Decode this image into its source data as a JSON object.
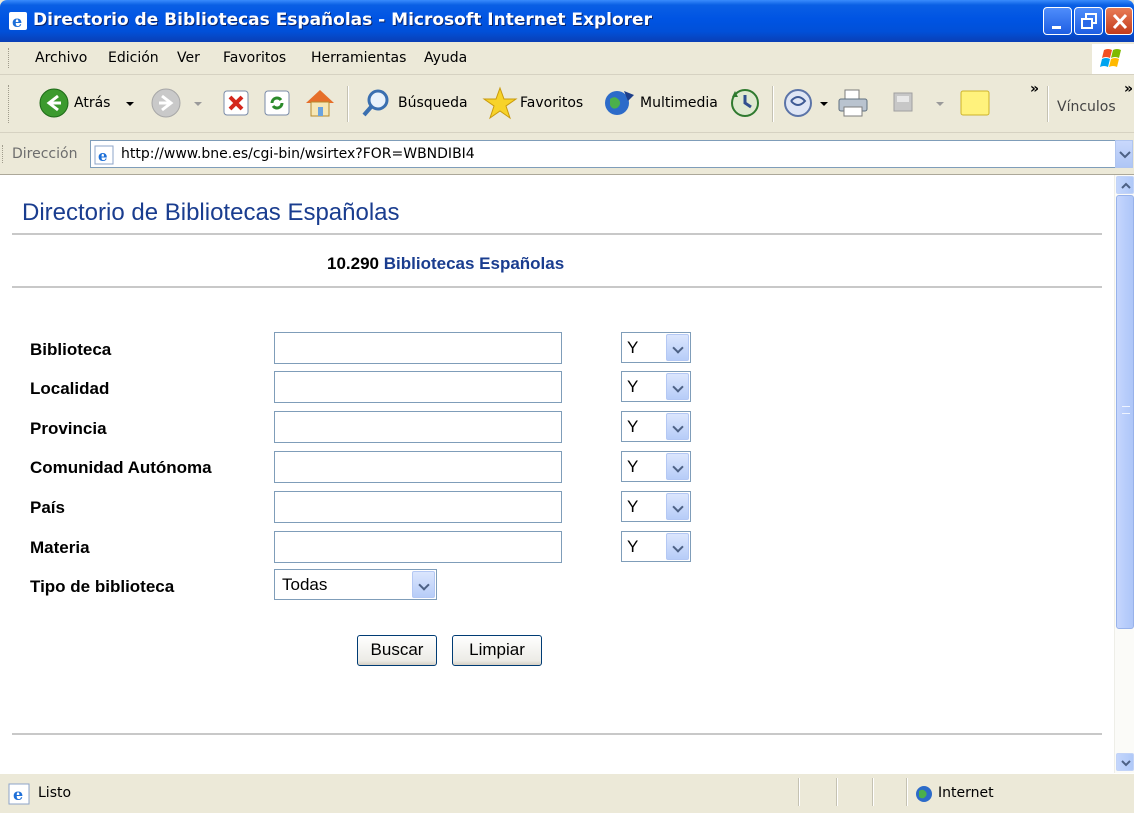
{
  "window": {
    "title": "Directorio de Bibliotecas Españolas - Microsoft Internet Explorer"
  },
  "menu": {
    "items": [
      "Archivo",
      "Edición",
      "Ver",
      "Favoritos",
      "Herramientas",
      "Ayuda"
    ]
  },
  "toolbar": {
    "back_label": "Atrás",
    "search_label": "Búsqueda",
    "favorites_label": "Favoritos",
    "media_label": "Multimedia",
    "links_label": "Vínculos",
    "more_symbol": "»"
  },
  "address_bar": {
    "label": "Dirección",
    "url": "http://www.bne.es/cgi-bin/wsirtex?FOR=WBNDIBI4"
  },
  "page": {
    "title": "Directorio de Bibliotecas Españolas",
    "count_number": "10.290",
    "count_label": "Bibliotecas Españolas",
    "fields": [
      {
        "label": "Biblioteca",
        "value": "",
        "operator": "Y"
      },
      {
        "label": "Localidad",
        "value": "",
        "operator": "Y"
      },
      {
        "label": "Provincia",
        "value": "",
        "operator": "Y"
      },
      {
        "label": "Comunidad Autónoma",
        "value": "",
        "operator": "Y"
      },
      {
        "label": "País",
        "value": "",
        "operator": "Y"
      },
      {
        "label": "Materia",
        "value": "",
        "operator": "Y"
      }
    ],
    "type_label": "Tipo de biblioteca",
    "type_value": "Todas",
    "search_button": "Buscar",
    "clear_button": "Limpiar"
  },
  "status_bar": {
    "status": "Listo",
    "zone": "Internet"
  },
  "colors": {
    "titlebar": "#0054e3",
    "link_blue": "#1a3d8f",
    "chrome": "#ece9d8"
  }
}
